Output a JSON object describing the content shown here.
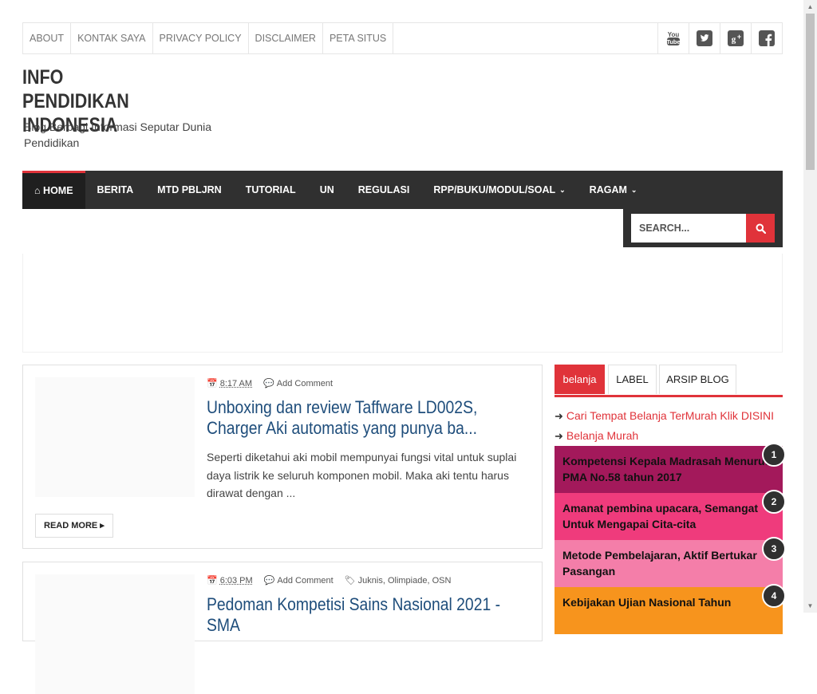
{
  "topbar": {
    "links": [
      "ABOUT",
      "KONTAK SAYA",
      "PRIVACY POLICY",
      "DISCLAIMER",
      "PETA SITUS"
    ],
    "social_icons": [
      "youtube-icon",
      "twitter-icon",
      "google-plus-icon",
      "facebook-icon"
    ]
  },
  "header": {
    "title_line1": "INFO PENDIDIKAN",
    "title_line2": "INDONESIA",
    "description": "Blog Berbagi Informasi Seputar Dunia Pendidikan"
  },
  "nav": {
    "home": "HOME",
    "items": [
      "BERITA",
      "MTD PBLJRN",
      "TUTORIAL",
      "UN",
      "REGULASI"
    ],
    "dropdowns": [
      "RPP/BUKU/MODUL/SOAL",
      "RAGAM"
    ],
    "search_placeholder": "SEARCH..."
  },
  "posts": [
    {
      "time": "8:17 AM",
      "comment": "Add Comment",
      "title": "Unboxing dan review Taffware LD002S, Charger Aki automatis yang punya ba...",
      "excerpt": "Seperti diketahui aki mobil mempunyai fungsi vital untuk suplai daya listrik ke seluruh komponen mobil. Maka aki tentu harus dirawat dengan ...",
      "read_more": "READ MORE"
    },
    {
      "time": "6:03 PM",
      "comment": "Add Comment",
      "labels": "Juknis, Olimpiade, OSN",
      "title": "Pedoman Kompetisi Sains Nasional 2021 - SMA"
    }
  ],
  "sidebar": {
    "tabs": [
      "belanja",
      "LABEL",
      "ARSIP BLOG"
    ],
    "links": [
      "Cari Tempat Belanja TerMurah Klik DISINI",
      "Belanja Murah"
    ],
    "popular": [
      {
        "num": "1",
        "title": "Kompetensi Kepala Madrasah Menurut PMA No.58 tahun 2017",
        "color": "#a3195b"
      },
      {
        "num": "2",
        "title": "Amanat pembina upacara, Semangat Untuk Mengapai Cita-cita",
        "color": "#ef3b7c"
      },
      {
        "num": "3",
        "title": "Metode Pembelajaran, Aktif Bertukar Pasangan",
        "color": "#f47ea9"
      },
      {
        "num": "4",
        "title": "Kebijakan Ujian Nasional Tahun",
        "color": "#f7941d"
      }
    ]
  },
  "colors": {
    "accent": "#e0333a",
    "nav_bg": "#303030",
    "title_blue": "#1e4d7b"
  }
}
